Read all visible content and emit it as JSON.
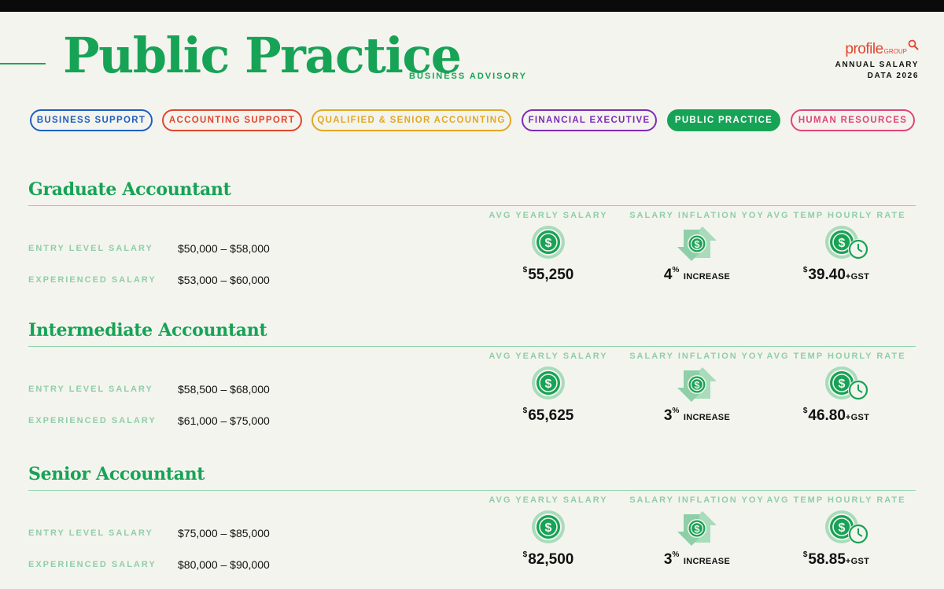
{
  "header": {
    "title": "Public Practice",
    "subtitle": "BUSINESS ADVISORY",
    "brand": {
      "word": "profile",
      "sub": "GROUP",
      "line1": "ANNUAL SALARY",
      "line2": "DATA 2026"
    }
  },
  "tabs": [
    {
      "label": "BUSINESS SUPPORT",
      "color": "#1f5fbf",
      "active": false
    },
    {
      "label": "ACCOUNTING SUPPORT",
      "color": "#e2452f",
      "active": false
    },
    {
      "label": "QUALIFIED & SENIOR ACCOUNTING",
      "color": "#e2a823",
      "active": false
    },
    {
      "label": "FINANCIAL EXECUTIVE",
      "color": "#7d2cb8",
      "active": false
    },
    {
      "label": "PUBLIC PRACTICE",
      "color": "#17a356",
      "active": true
    },
    {
      "label": "HUMAN RESOURCES",
      "color": "#e0457b",
      "active": false
    }
  ],
  "labels": {
    "entry": "ENTRY LEVEL SALARY",
    "experienced": "EXPERIENCED SALARY",
    "avg_yearly": "AVG YEARLY SALARY",
    "inflation": "SALARY INFLATION YOY",
    "temp_rate": "AVG TEMP HOURLY RATE",
    "dollar": "$",
    "percent": "%",
    "increase": "INCREASE",
    "gst": "+GST"
  },
  "sections": [
    {
      "title": "Graduate Accountant",
      "entry": "$50,000 – $58,000",
      "experienced": "$53,000 – $60,000",
      "avg": "55,250",
      "inflation": "4",
      "rate": "39.40"
    },
    {
      "title": "Intermediate Accountant",
      "entry": "$58,500 – $68,000",
      "experienced": "$61,000 – $75,000",
      "avg": "65,625",
      "inflation": "3",
      "rate": "46.80"
    },
    {
      "title": "Senior Accountant",
      "entry": "$75,000 – $85,000",
      "experienced": "$80,000 – $90,000",
      "avg": "82,500",
      "inflation": "3",
      "rate": "58.85"
    }
  ],
  "colors": {
    "accent": "#17a356",
    "muted": "#8ecfa7",
    "background": "#f4f4ee",
    "brand": "#e2452f"
  }
}
